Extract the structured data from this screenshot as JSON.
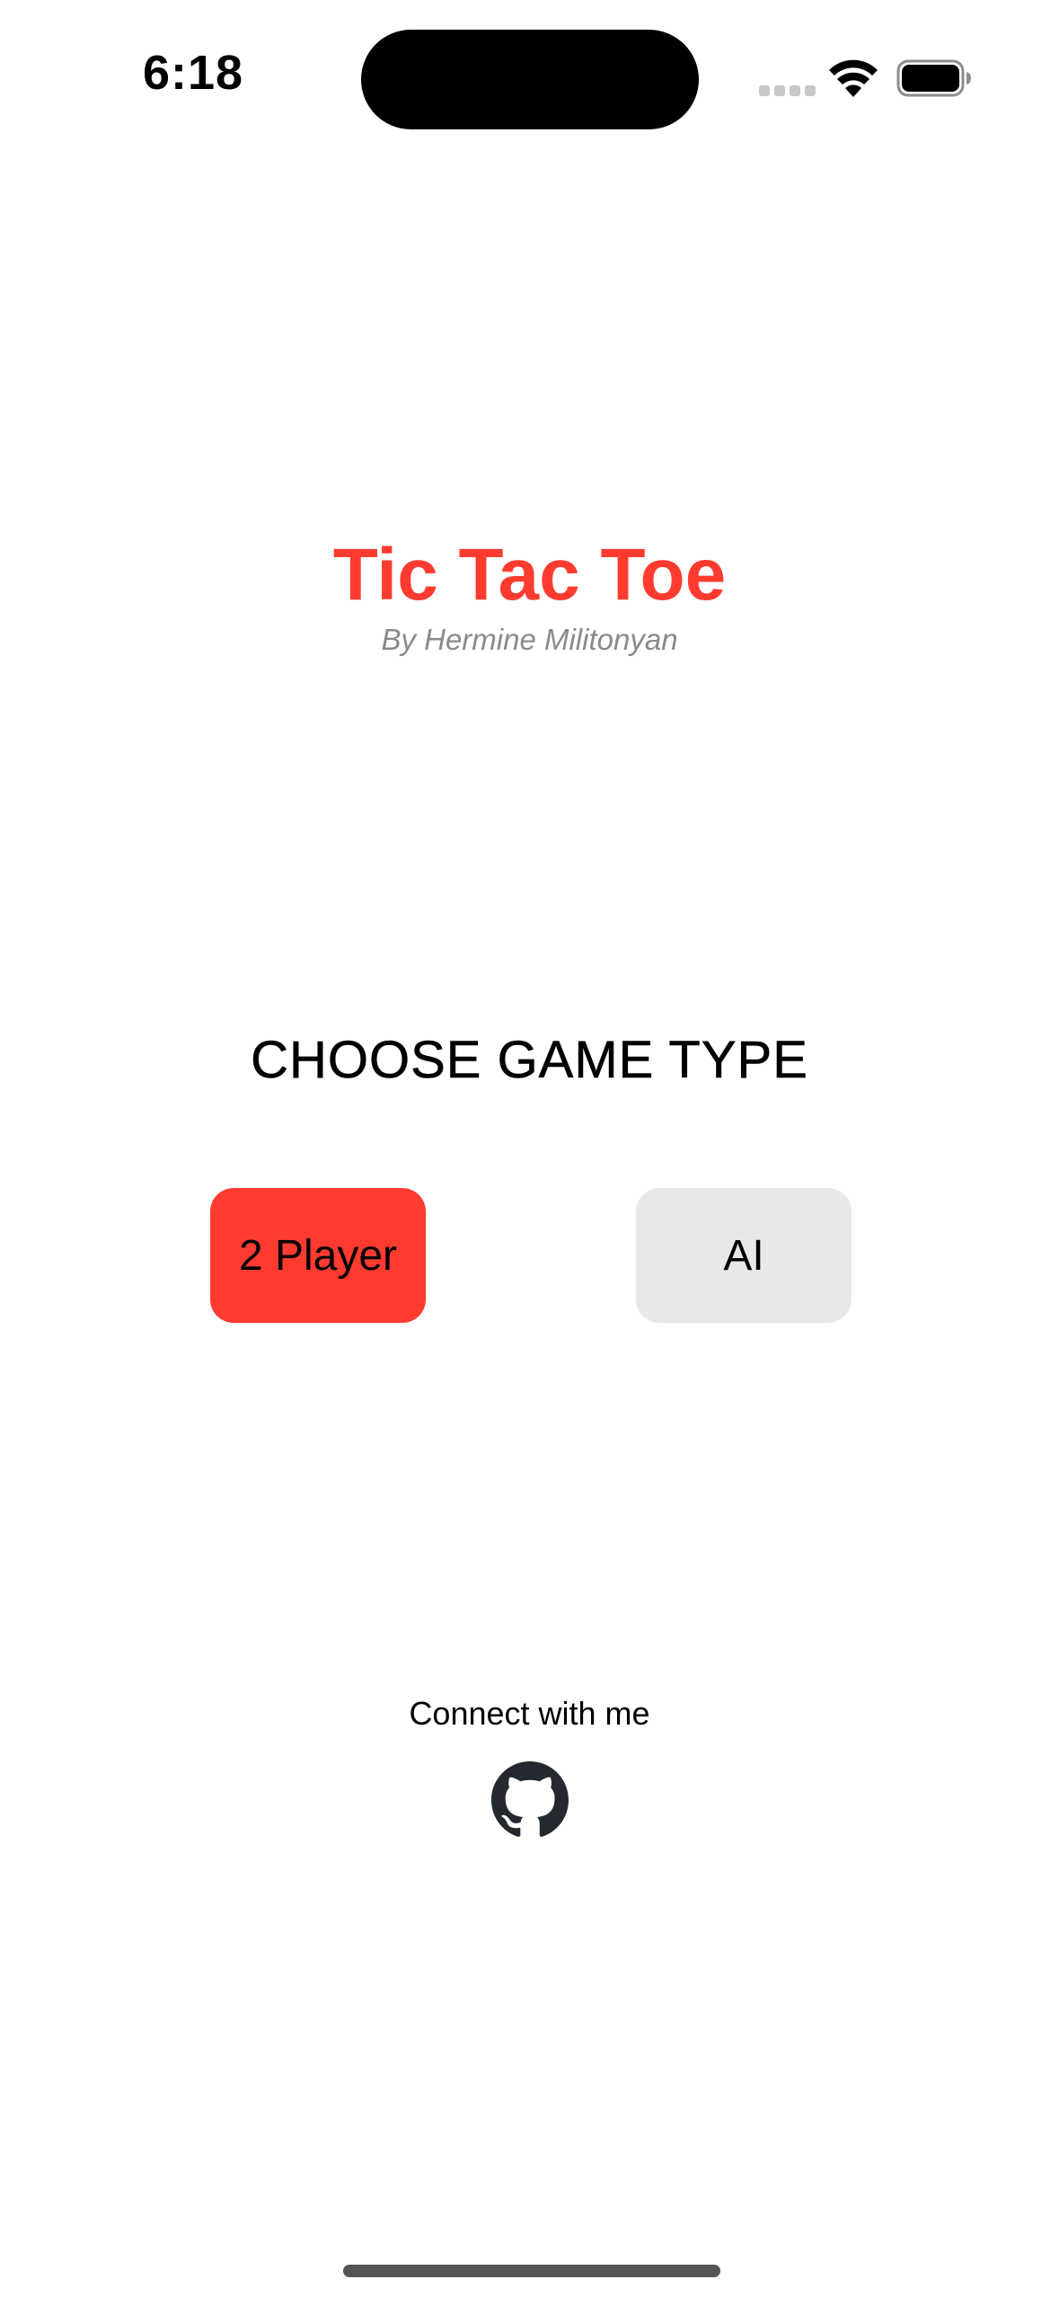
{
  "status_bar": {
    "time": "6:18",
    "icons": [
      "signal-icon",
      "wifi-icon",
      "battery-icon"
    ]
  },
  "header": {
    "title": "Tic Tac Toe",
    "subtitle": "By Hermine Militonyan"
  },
  "game_type": {
    "heading": "CHOOSE GAME TYPE",
    "options": [
      {
        "label": "2 Player",
        "selected": true,
        "color": "#ff3b30"
      },
      {
        "label": "AI",
        "selected": false,
        "color": "#e8e8e8"
      }
    ]
  },
  "footer": {
    "connect_label": "Connect with me",
    "link_icon": "github-icon"
  },
  "colors": {
    "accent": "#ff3b30",
    "subtitle": "#8a8a8e",
    "unselected_button": "#e8e8e8",
    "github": "#24292f"
  }
}
